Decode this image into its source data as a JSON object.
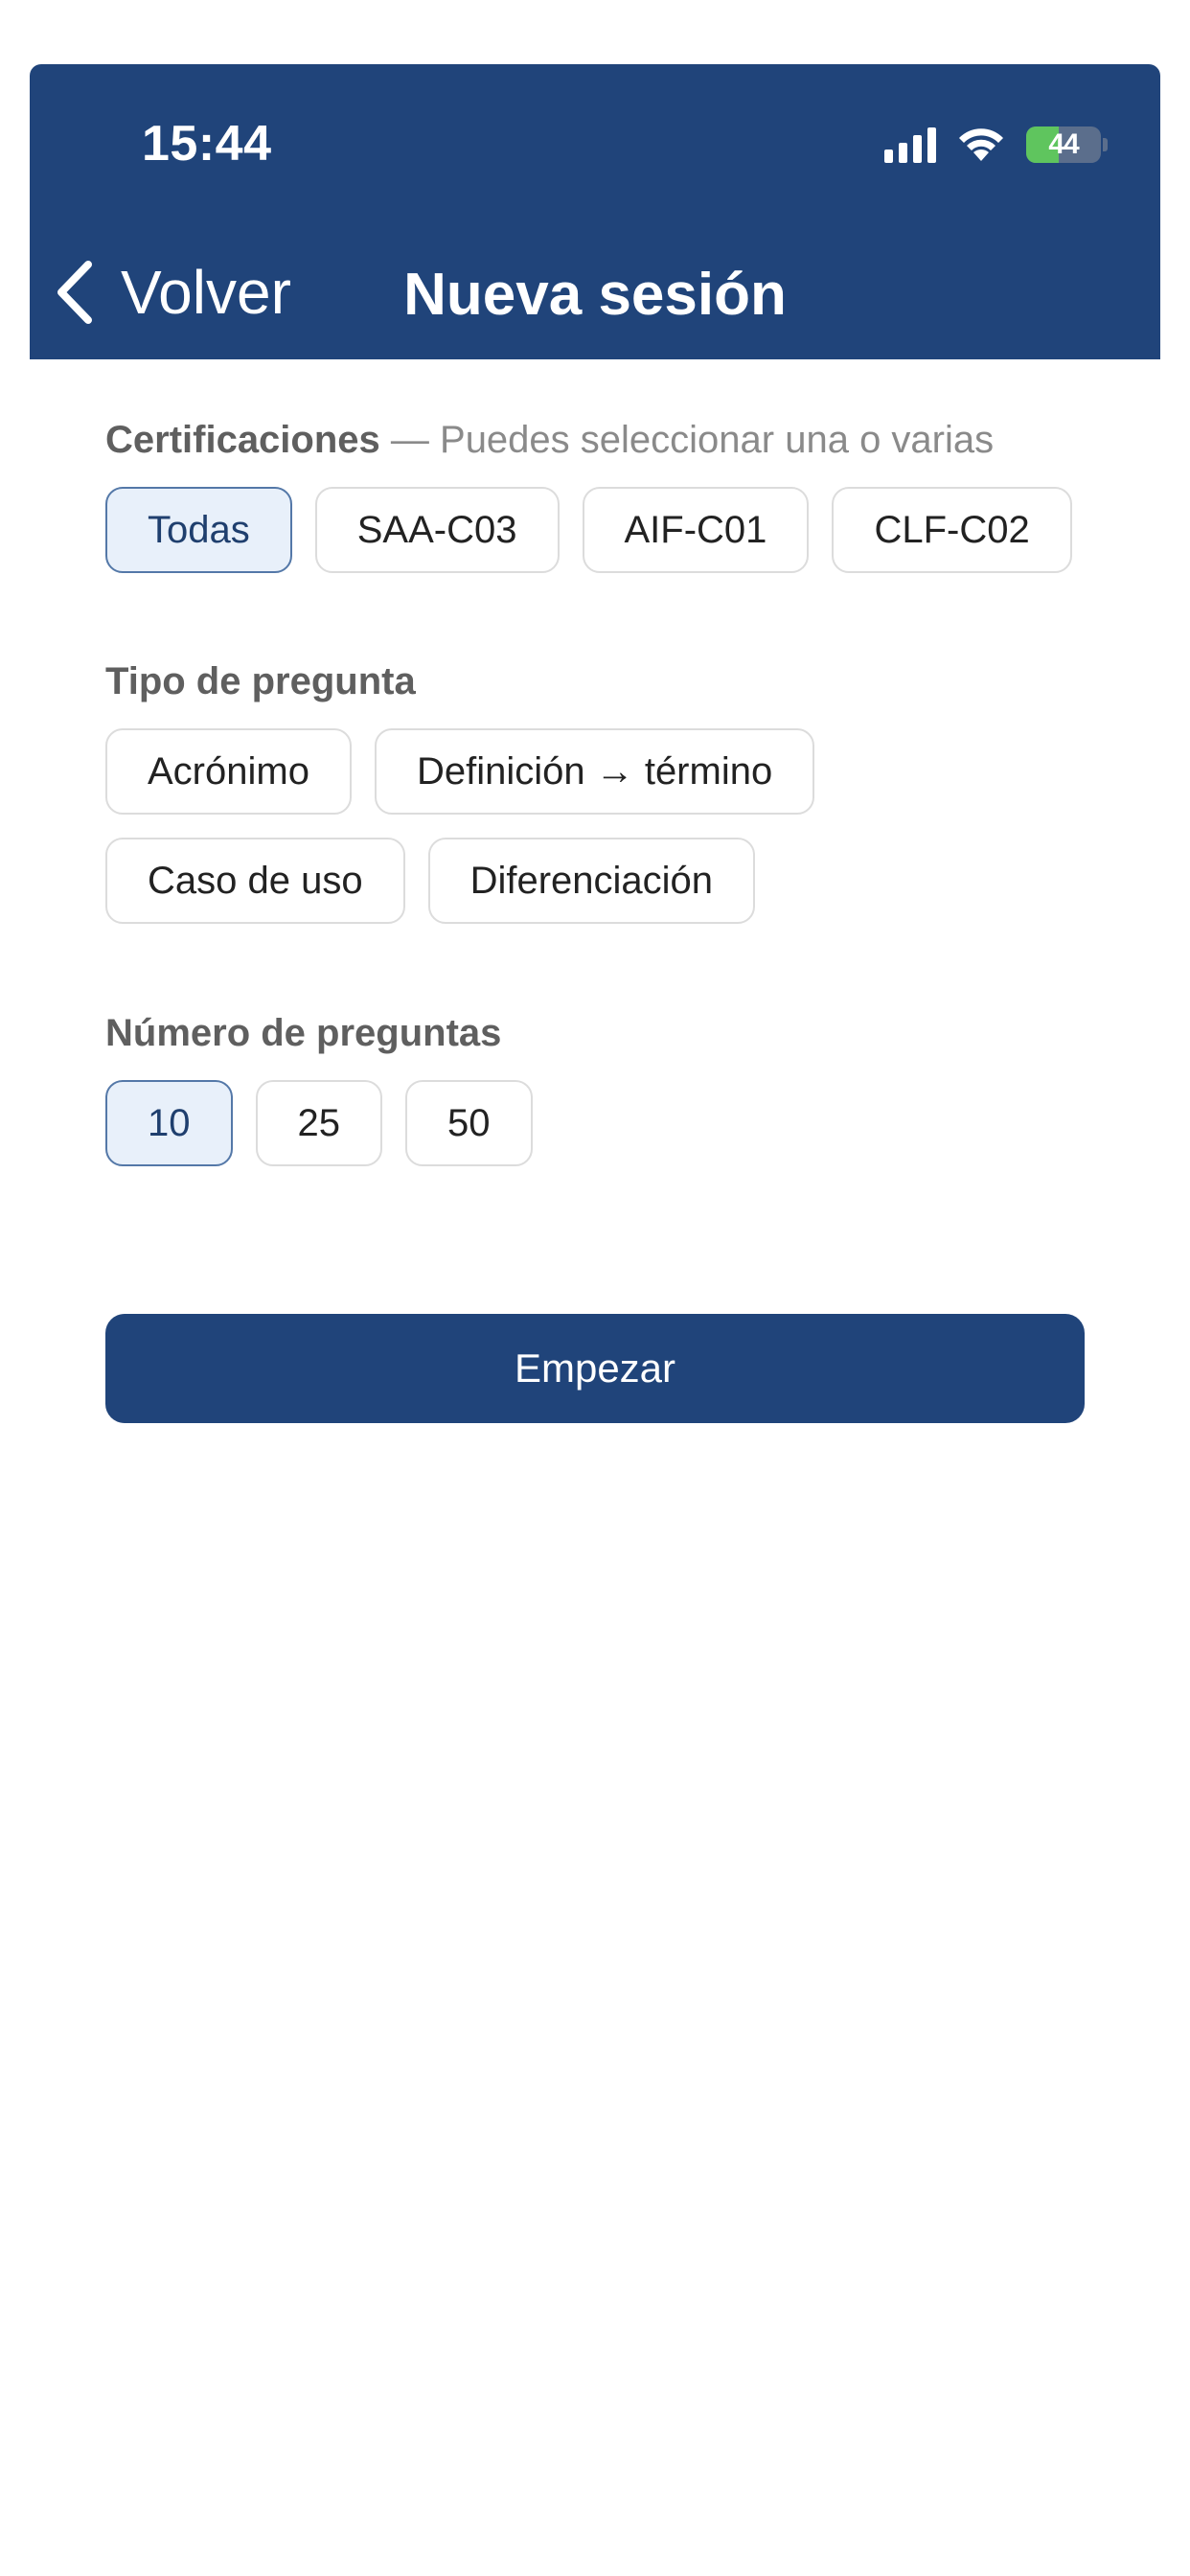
{
  "status_bar": {
    "time": "15:44",
    "battery_level": "44",
    "battery_fraction": 0.44
  },
  "nav": {
    "back_label": "Volver",
    "title": "Nueva sesión"
  },
  "certifications": {
    "label": "Certificaciones",
    "hint": " — Puedes seleccionar una o varias",
    "options": [
      {
        "label": "Todas",
        "selected": true
      },
      {
        "label": "SAA-C03",
        "selected": false
      },
      {
        "label": "AIF-C01",
        "selected": false
      },
      {
        "label": "CLF-C02",
        "selected": false
      }
    ]
  },
  "question_type": {
    "label": "Tipo de pregunta",
    "options": [
      {
        "label": "Acrónimo",
        "selected": false
      },
      {
        "label": "Definición → término",
        "selected": false
      },
      {
        "label": "Caso de uso",
        "selected": false
      },
      {
        "label": "Diferenciación",
        "selected": false
      }
    ]
  },
  "question_count": {
    "label": "Número de preguntas",
    "options": [
      {
        "label": "10",
        "selected": true
      },
      {
        "label": "25",
        "selected": false
      },
      {
        "label": "50",
        "selected": false
      }
    ]
  },
  "start_button": "Empezar",
  "colors": {
    "header_bg": "#20447a",
    "selected_chip_bg": "#e8f0fa",
    "selected_chip_border": "#5478a8",
    "battery_green": "#5fc55e"
  }
}
